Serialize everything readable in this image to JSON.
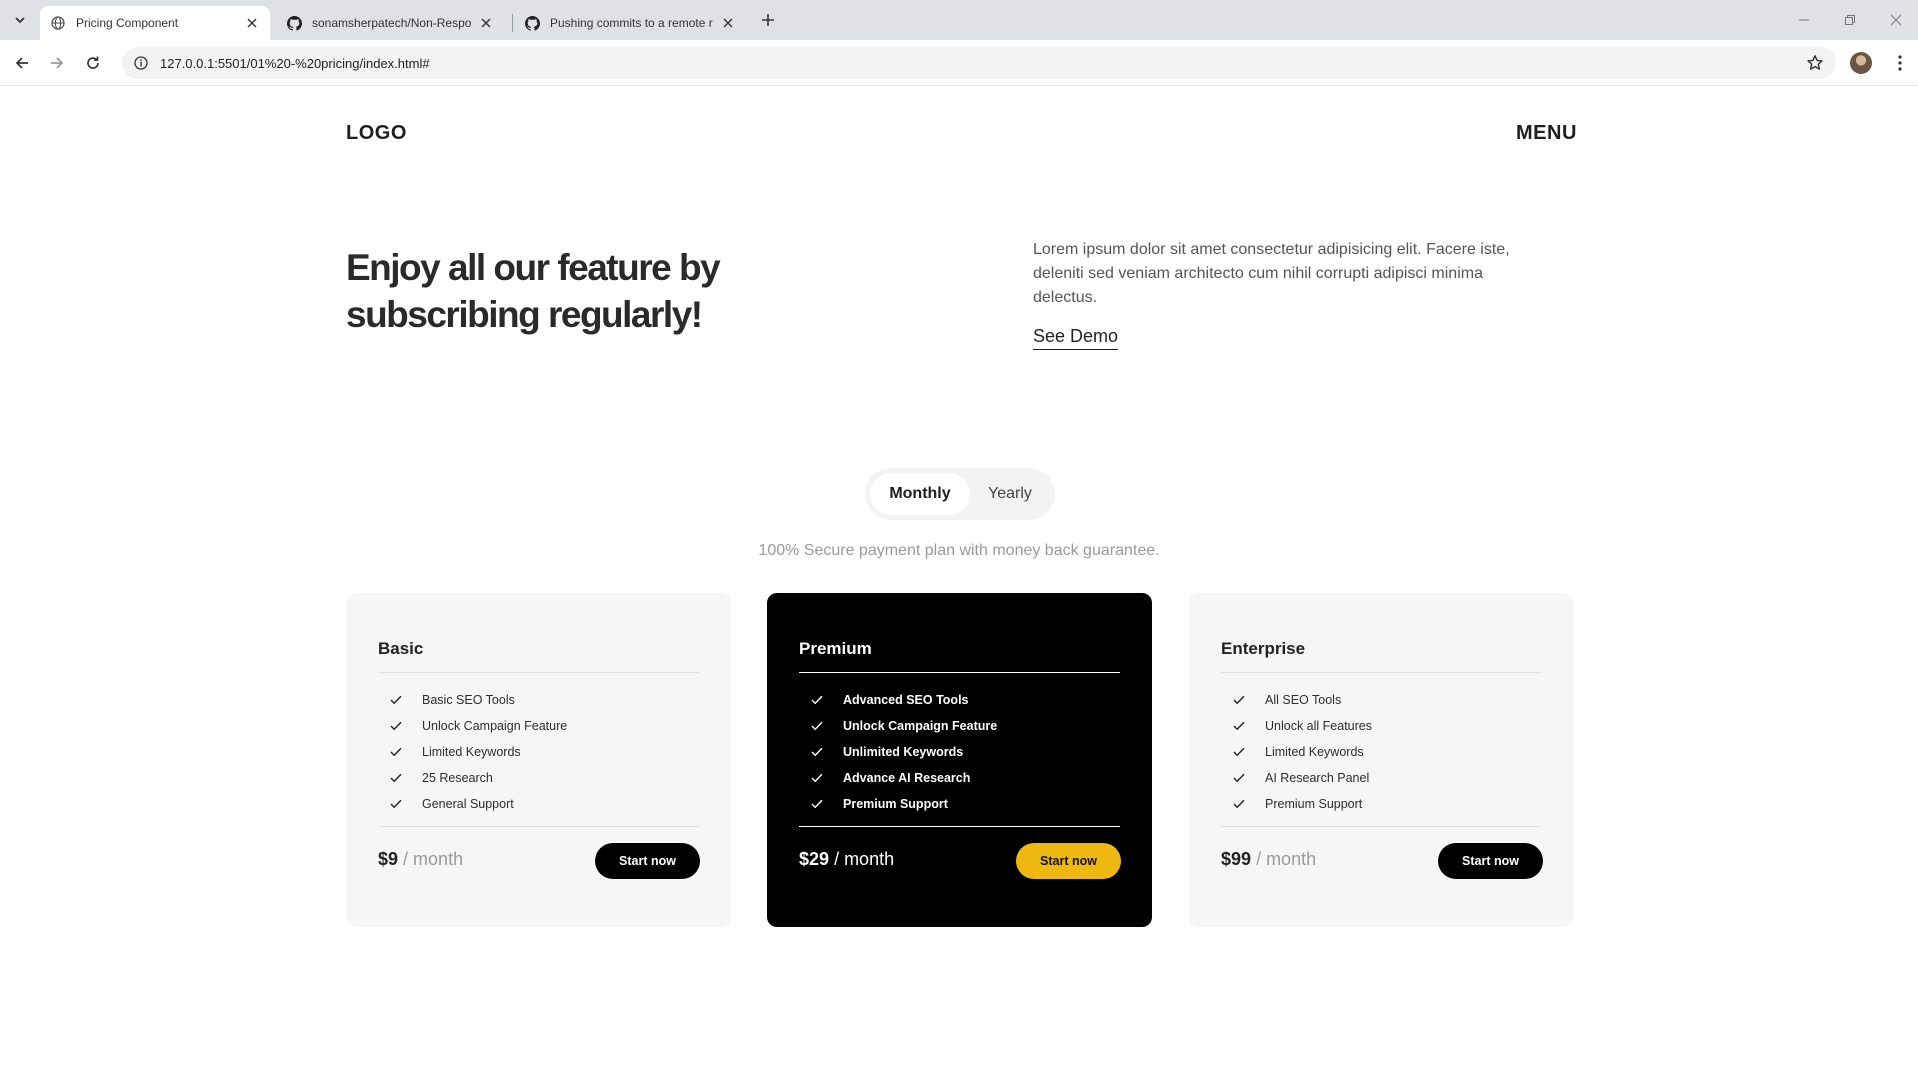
{
  "browser": {
    "tabs": [
      {
        "title": "Pricing Component",
        "active": true
      },
      {
        "title": "sonamsherpatech/Non-Respon",
        "active": false
      },
      {
        "title": "Pushing commits to a remote r",
        "active": false
      }
    ],
    "url": "127.0.0.1:5501/01%20-%20pricing/index.html#"
  },
  "header": {
    "logo": "LOGO",
    "menu": "MENU"
  },
  "hero": {
    "title": "Enjoy all our feature by subscribing regularly!",
    "description": "Lorem ipsum dolor sit amet consectetur adipisicing elit. Facere iste, deleniti sed veniam architecto cum nihil corrupti adipisci minima delectus.",
    "demo_link": "See Demo"
  },
  "billing_toggle": {
    "options": [
      "Monthly",
      "Yearly"
    ],
    "selected": "Monthly"
  },
  "guarantee": "100% Secure payment plan with money back guarantee.",
  "plans": [
    {
      "name": "Basic",
      "features": [
        "Basic SEO Tools",
        "Unlock Campaign Feature",
        "Limited Keywords",
        "25 Research",
        "General Support"
      ],
      "price": "$9",
      "period": "/ month",
      "cta": "Start now"
    },
    {
      "name": "Premium",
      "features": [
        "Advanced SEO Tools",
        "Unlock Campaign Feature",
        "Unlimited Keywords",
        "Advance AI Research",
        "Premium Support"
      ],
      "price": "$29",
      "period": "/ month",
      "cta": "Start now"
    },
    {
      "name": "Enterprise",
      "features": [
        "All SEO Tools",
        "Unlock all Features",
        "Limited Keywords",
        "AI Research Panel",
        "Premium Support"
      ],
      "price": "$99",
      "period": "/ month",
      "cta": "Start now"
    }
  ],
  "colors": {
    "accent": "#efb810",
    "featured_bg": "#000000",
    "card_bg": "#f6f6f6"
  },
  "icons": [
    "tab-search-icon",
    "globe-icon",
    "github-icon",
    "close-icon",
    "new-tab-icon",
    "minimize-icon",
    "restore-icon",
    "back-icon",
    "forward-icon",
    "reload-icon",
    "site-info-icon",
    "bookmark-star-icon",
    "profile-avatar",
    "more-menu-icon",
    "check-icon"
  ]
}
